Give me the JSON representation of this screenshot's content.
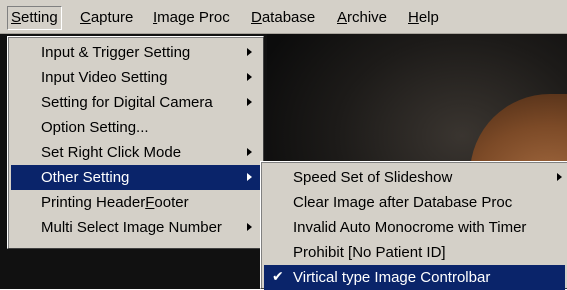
{
  "menubar": {
    "items": [
      {
        "label": "Setting",
        "access": "S",
        "rest": "etting"
      },
      {
        "label": "Capture",
        "access": "C",
        "rest": "apture"
      },
      {
        "label": "Image Proc",
        "access": "I",
        "rest": "mage Proc"
      },
      {
        "label": "Database",
        "access": "D",
        "rest": "atabase"
      },
      {
        "label": "Archive",
        "access": "A",
        "rest": "rchive"
      },
      {
        "label": "Help",
        "access": "H",
        "rest": "elp"
      }
    ],
    "active_item": "Setting"
  },
  "setting_menu": {
    "items": [
      {
        "label": "Input & Trigger Setting",
        "submenu": true
      },
      {
        "label": "Input Video Setting",
        "submenu": true
      },
      {
        "label": "Setting for Digital Camera",
        "submenu": true
      },
      {
        "label": "Option Setting...",
        "submenu": false
      },
      {
        "label": "Set Right Click Mode",
        "submenu": true
      },
      {
        "label": "Other Setting",
        "submenu": true,
        "highlighted": true
      },
      {
        "pre": "Printing Header",
        "access": "F",
        "post": "ooter",
        "submenu": false
      },
      {
        "label": "Multi Select Image Number",
        "submenu": true
      }
    ]
  },
  "other_setting_menu": {
    "items": [
      {
        "label": "Speed Set of Slideshow",
        "submenu": true
      },
      {
        "label": "Clear Image after Database Proc",
        "submenu": false
      },
      {
        "label": "Invalid Auto Monocrome with Timer",
        "submenu": false
      },
      {
        "label": "Prohibit [No Patient ID]",
        "submenu": false
      },
      {
        "label": "Virtical type Image Controlbar",
        "submenu": false,
        "checked": true,
        "highlighted": true
      }
    ],
    "check_mark": "✔"
  },
  "colors": {
    "menu_bg": "#d4d0c8",
    "highlight": "#0a246a",
    "highlight_text": "#ffffff"
  }
}
